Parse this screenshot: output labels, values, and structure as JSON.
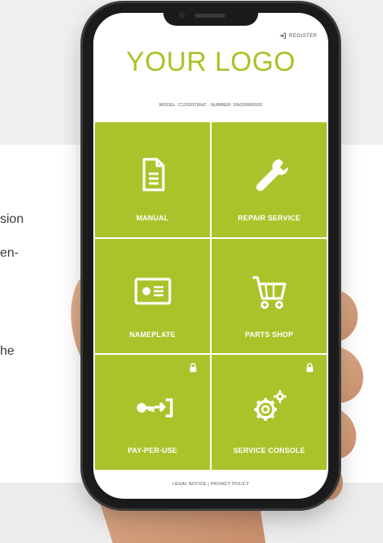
{
  "background": {
    "text_fragments": [
      "sion",
      "en-",
      "he"
    ]
  },
  "app": {
    "register_label": "REGISTER",
    "logo_text": "YOUR LOGO",
    "model_line": "MODEL: C12020TRHC · NUMBER: SN030900002",
    "footer": "LEGAL NOTICE | PRIVACY POLICY"
  },
  "tiles": [
    {
      "label": "MANUAL",
      "icon": "document-icon",
      "locked": false
    },
    {
      "label": "REPAIR SERVICE",
      "icon": "wrench-icon",
      "locked": false
    },
    {
      "label": "NAMEPLATE",
      "icon": "id-card-icon",
      "locked": false
    },
    {
      "label": "PARTS SHOP",
      "icon": "cart-icon",
      "locked": false
    },
    {
      "label": "PAY-PER-USE",
      "icon": "key-login-icon",
      "locked": true
    },
    {
      "label": "SERVICE CONSOLE",
      "icon": "gears-icon",
      "locked": true
    }
  ],
  "colors": {
    "accent": "#a9c42a",
    "logo": "#a8c327",
    "phone_body": "#1b1b1b"
  }
}
